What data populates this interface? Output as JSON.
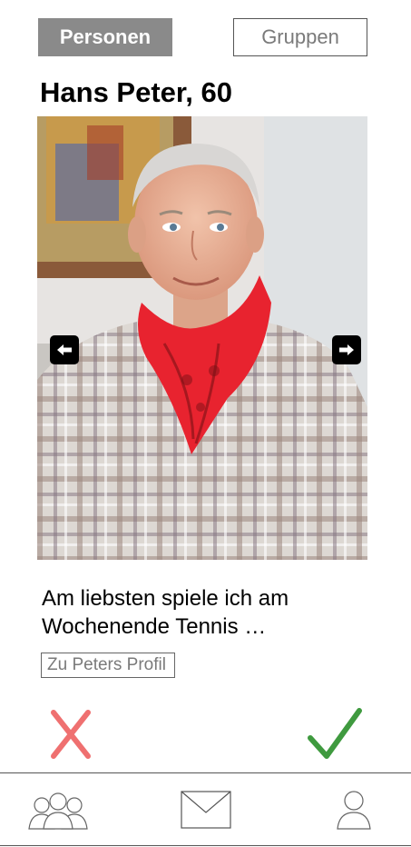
{
  "tabs": {
    "persons_label": "Personen",
    "groups_label": "Gruppen"
  },
  "profile": {
    "name_age": "Hans Peter, 60",
    "bio": "Am liebsten spiele ich am Wochenende Tennis …",
    "profile_link_label": "Zu Peters Profil"
  },
  "icons": {
    "prev": "arrow-left-icon",
    "next": "arrow-right-icon",
    "reject": "x-icon",
    "accept": "checkmark-icon",
    "groups": "group-icon",
    "messages": "envelope-icon",
    "account": "user-icon"
  },
  "colors": {
    "active_tab": "#8a8a8a",
    "reject": "#ef7070",
    "accept": "#3f9a3f"
  }
}
